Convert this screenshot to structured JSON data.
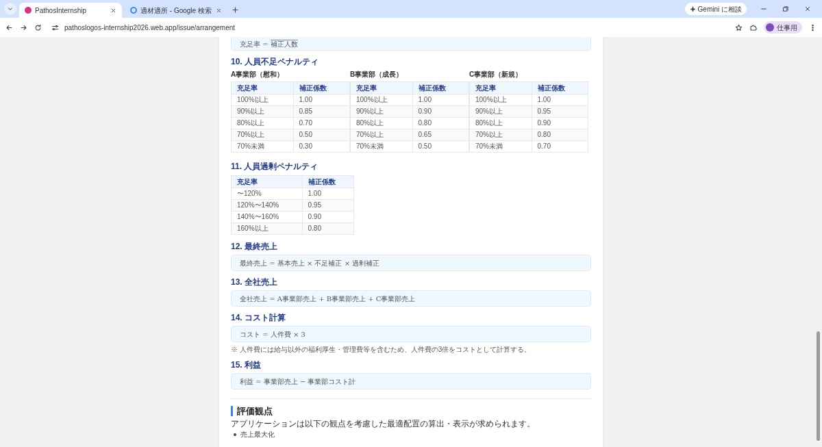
{
  "browser": {
    "tabs": [
      {
        "title": "PathosInternship",
        "selected": true
      },
      {
        "title": "適材適所 - Google 検索",
        "selected": false
      }
    ],
    "gemini_button": "Gemini に相談",
    "url": "pathoslogos-internship2026.web.app/issue/arrangement",
    "profile": "仕事用"
  },
  "top_formula": {
    "lhs": "充足率 =",
    "denominator": "補正人数"
  },
  "shortage": {
    "heading": "10. 人員不足ペナルティ",
    "tables": [
      {
        "title": "A事業部（慰和）",
        "columns": [
          "充足率",
          "補正係数"
        ],
        "rows": [
          [
            "100%以上",
            "1.00"
          ],
          [
            "90%以上",
            "0.85"
          ],
          [
            "80%以上",
            "0.70"
          ],
          [
            "70%以上",
            "0.50"
          ],
          [
            "70%未満",
            "0.30"
          ]
        ]
      },
      {
        "title": "B事業部（成長）",
        "columns": [
          "充足率",
          "補正係数"
        ],
        "rows": [
          [
            "100%以上",
            "1.00"
          ],
          [
            "90%以上",
            "0.90"
          ],
          [
            "80%以上",
            "0.80"
          ],
          [
            "70%以上",
            "0.65"
          ],
          [
            "70%未満",
            "0.50"
          ]
        ]
      },
      {
        "title": "C事業部（新規）",
        "columns": [
          "充足率",
          "補正係数"
        ],
        "rows": [
          [
            "100%以上",
            "1.00"
          ],
          [
            "90%以上",
            "0.95"
          ],
          [
            "80%以上",
            "0.90"
          ],
          [
            "70%以上",
            "0.80"
          ],
          [
            "70%未満",
            "0.70"
          ]
        ]
      }
    ]
  },
  "excess": {
    "heading": "11. 人員過剰ペナルティ",
    "columns": [
      "充足率",
      "補正係数"
    ],
    "rows": [
      [
        "〜120%",
        "1.00"
      ],
      [
        "120%〜140%",
        "0.95"
      ],
      [
        "140%〜160%",
        "0.90"
      ],
      [
        "160%以上",
        "0.80"
      ]
    ]
  },
  "sections": [
    {
      "heading": "12. 最終売上",
      "formula": "最終売上 = 基本売上 × 不足補正 × 過剰補正"
    },
    {
      "heading": "13. 全社売上",
      "formula": "全社売上 = A事業部売上 + B事業部売上 + C事業部売上"
    },
    {
      "heading": "14. コスト計算",
      "formula": "コスト = 人件費 × 3",
      "note": "※ 人件費には給与以外の福利厚生・管理費等を含むため、人件費の3倍をコストとして計算する。"
    },
    {
      "heading": "15. 利益",
      "formula": "利益 = 事業部売上 − 事業部コスト計"
    }
  ],
  "evaluation": {
    "heading": "評価観点",
    "intro": "アプリケーションは以下の観点を考慮した最適配置の算出・表示が求められます。",
    "items": [
      "売上最大化"
    ]
  }
}
